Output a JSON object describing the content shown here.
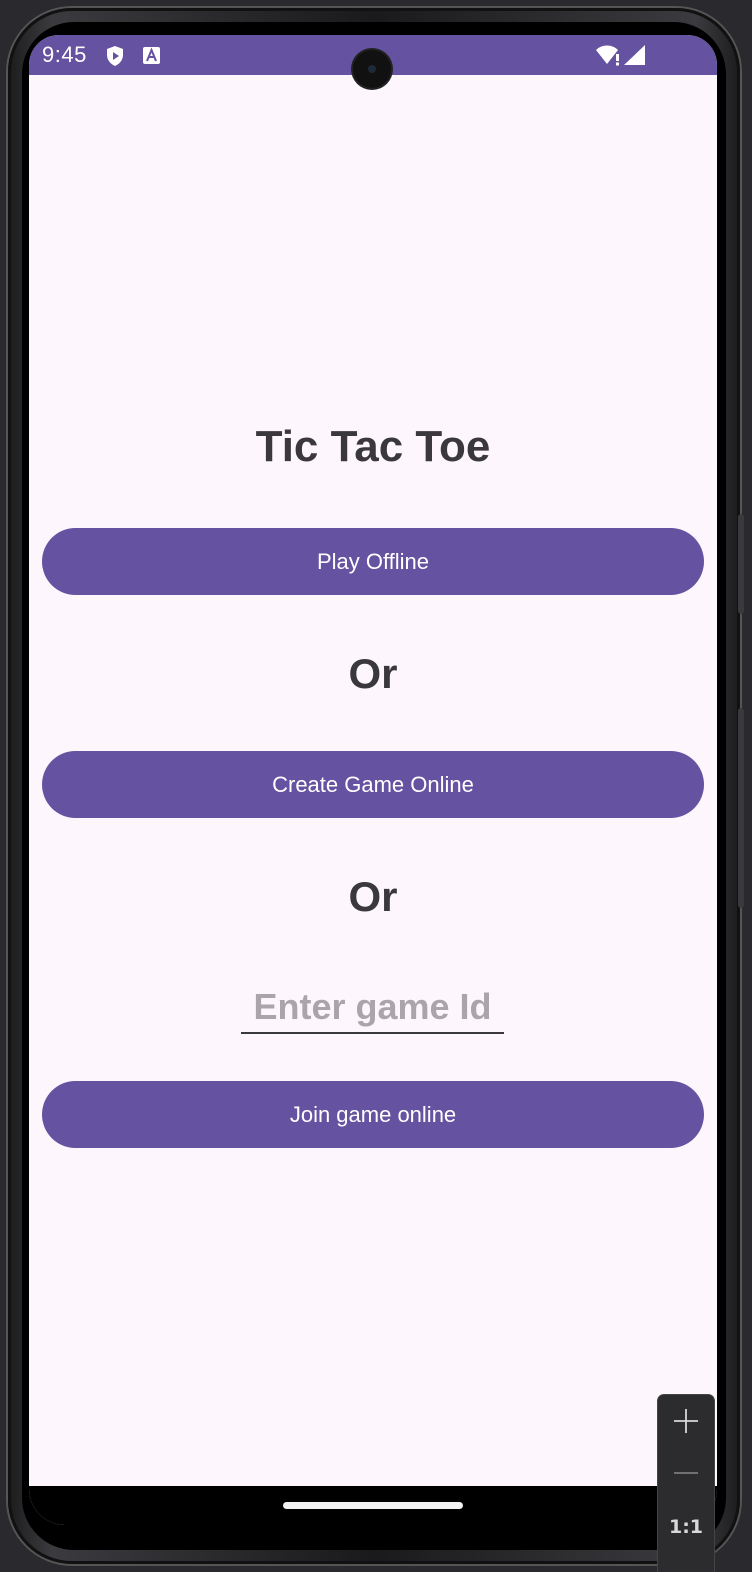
{
  "status_bar": {
    "time": "9:45",
    "icons": [
      "shield-play-icon",
      "font-a-icon",
      "wifi-alert-icon",
      "signal-icon"
    ]
  },
  "main": {
    "title": "Tic Tac Toe",
    "play_offline_label": "Play Offline",
    "or_label_1": "Or",
    "create_game_label": "Create Game Online",
    "or_label_2": "Or",
    "game_id_input": {
      "placeholder": "Enter game Id",
      "value": ""
    },
    "join_game_label": "Join game online"
  },
  "zoom_controls": {
    "zoom_in": "+",
    "zoom_out": "—",
    "actual_size": "1:1"
  },
  "colors": {
    "primary": "#6552a0",
    "background": "#fdf7fd",
    "text": "#3a383d",
    "hint": "#a9a5ab"
  }
}
